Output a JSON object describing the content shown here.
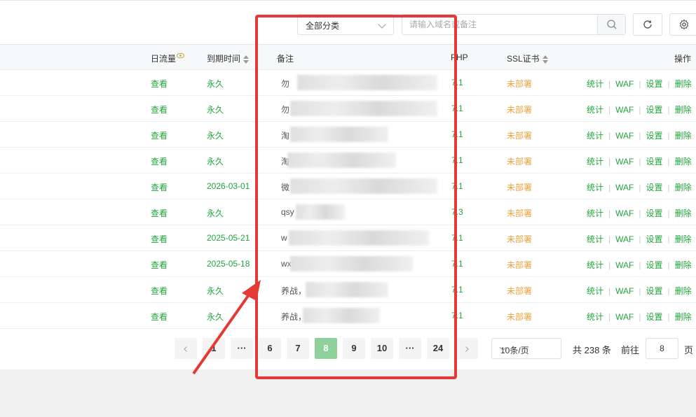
{
  "toolbar": {
    "category_select": "全部分类",
    "search_placeholder": "请输入域名或备注"
  },
  "columns": {
    "traffic": "日流量",
    "expire": "到期时间",
    "remark": "备注",
    "php": "PHP",
    "ssl": "SSL证书",
    "actions": "操作"
  },
  "rows": [
    {
      "traffic": "查看",
      "expire": "永久",
      "remark": "勿",
      "php": "7.1",
      "ssl": "未部署"
    },
    {
      "traffic": "查看",
      "expire": "永久",
      "remark": "勿",
      "php": "7.1",
      "ssl": "未部署"
    },
    {
      "traffic": "查看",
      "expire": "永久",
      "remark": "淘",
      "php": "7.1",
      "ssl": "未部署"
    },
    {
      "traffic": "查看",
      "expire": "永久",
      "remark": "淘",
      "php": "7.1",
      "ssl": "未部署"
    },
    {
      "traffic": "查看",
      "expire": "2026-03-01",
      "remark": "微",
      "php": "7.1",
      "ssl": "未部署"
    },
    {
      "traffic": "查看",
      "expire": "永久",
      "remark": "qsy",
      "php": "7.3",
      "ssl": "未部署"
    },
    {
      "traffic": "查看",
      "expire": "2025-05-21",
      "remark": "w",
      "php": "7.1",
      "ssl": "未部署"
    },
    {
      "traffic": "查看",
      "expire": "2025-05-18",
      "remark": "wx:",
      "php": "7.1",
      "ssl": "未部署"
    },
    {
      "traffic": "查看",
      "expire": "永久",
      "remark": "养战，",
      "php": "7.1",
      "ssl": "未部署"
    },
    {
      "traffic": "查看",
      "expire": "永久",
      "remark": "养战，",
      "php": "7.1",
      "ssl": "未部署"
    }
  ],
  "actions": {
    "stats": "统计",
    "waf": "WAF",
    "settings": "设置",
    "delete": "删除"
  },
  "pagination": {
    "pages": [
      "1",
      "···",
      "6",
      "7",
      "8",
      "9",
      "10",
      "···",
      "24"
    ],
    "current": "8",
    "page_size": "10条/页",
    "total": "共 238 条",
    "goto_label": "前往",
    "goto_value": "8",
    "page_suffix": "页"
  },
  "colors": {
    "accent": "#20a53a",
    "warning": "#e6a23c",
    "annotation": "#e53935"
  }
}
